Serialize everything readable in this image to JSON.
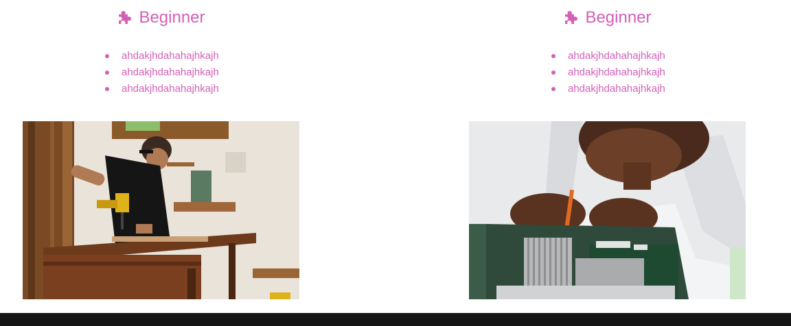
{
  "cards": [
    {
      "title": "Beginner",
      "icon": "puzzle-piece-icon",
      "items": [
        "ahdakjhdahahajhkajh",
        "ahdakjhdahahajhkajh",
        "ahdakjhdahahajhkajh"
      ],
      "image": "woodworker-drilling-photo"
    },
    {
      "title": "Beginner",
      "icon": "puzzle-piece-icon",
      "items": [
        "ahdakjhdahahajhkajh",
        "ahdakjhdahahajhkajh",
        "ahdakjhdahahajhkajh"
      ],
      "image": "technician-circuit-board-photo"
    }
  ],
  "colors": {
    "accent": "#d35fb7",
    "footer": "#151515",
    "background": "#ffffff"
  }
}
